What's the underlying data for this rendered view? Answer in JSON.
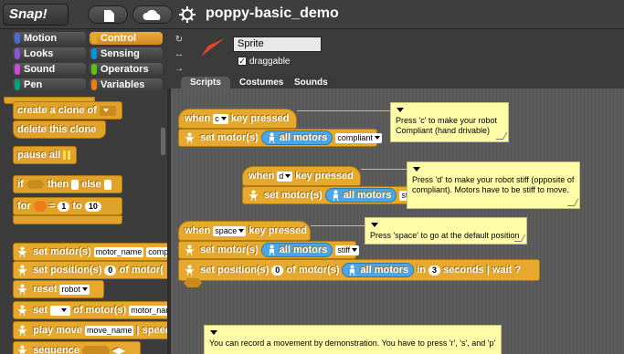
{
  "app": {
    "logo_text": "Snap!",
    "project_title": "poppy-basic_demo"
  },
  "categories": [
    {
      "label": "Motion",
      "color": "#4a6cd4"
    },
    {
      "label": "Control",
      "color": "#e6a82d",
      "selected": true
    },
    {
      "label": "Looks",
      "color": "#8a55d7"
    },
    {
      "label": "Sensing",
      "color": "#0494dc"
    },
    {
      "label": "Sound",
      "color": "#cf4ad9"
    },
    {
      "label": "Operators",
      "color": "#62c213"
    },
    {
      "label": "Pen",
      "color": "#00a178"
    },
    {
      "label": "Variables",
      "color": "#ee7d16"
    }
  ],
  "palette": {
    "create_clone": "create a clone of",
    "delete_clone": "delete this clone",
    "pause_all": "pause all",
    "if_then": "if",
    "then_label": "then",
    "else_label": "else",
    "for_label": "for",
    "for_eq": "=",
    "for_from": "1",
    "for_to_label": "to",
    "for_to": "10",
    "set_motors": "set motor(s)",
    "set_motors_slot": "motor_name",
    "set_motors_slot2": "compl",
    "set_position": "set position(s)",
    "set_position_val": "0",
    "set_position_of": "of motor(",
    "reset": "reset",
    "reset_slot": "robot",
    "set_label": "set",
    "set_of": "of motor(s)",
    "set_slot": "motor_nam",
    "play_move": "play move",
    "play_move_slot": "move_name",
    "play_speed": "| speed",
    "sequence": "sequence"
  },
  "sprite": {
    "name": "Sprite",
    "draggable_label": "draggable",
    "draggable_checked": true
  },
  "tabs": [
    {
      "label": "Scripts",
      "active": true
    },
    {
      "label": "Costumes",
      "active": false
    },
    {
      "label": "Sounds",
      "active": false
    }
  ],
  "scripts": {
    "when_label": "when",
    "key_pressed": "key pressed",
    "key_c": "c",
    "key_d": "d",
    "key_space": "space",
    "set_motors": "set motor(s)",
    "all_motors": "all motors",
    "compliant": "compliant",
    "stiff": "stiff",
    "set_position": "set position(s)",
    "pos_value": "0",
    "of_motors": "of motor(s)",
    "in_label": "in",
    "seconds_value": "3",
    "seconds_wait": "seconds | wait ?"
  },
  "notes": {
    "note_c": "Press 'c' to make your robot Compliant (hand drivable)",
    "note_d": "Press 'd' to make your robot stiff (opposite of compliant). Motors have to be stiff to move.",
    "note_space": "Press 'space' to go at the default position",
    "note_record": "You can record a movement by demonstration. You have to press 'r', 's', and 'p'"
  }
}
